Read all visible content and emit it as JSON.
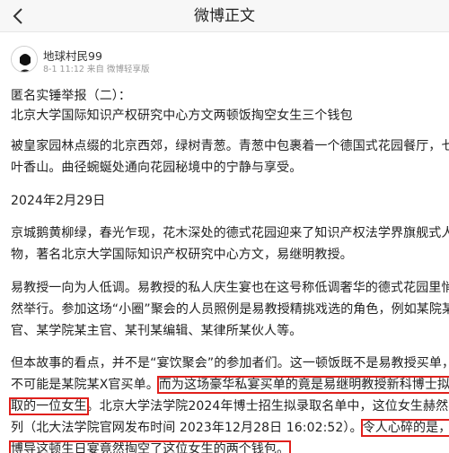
{
  "nav": {
    "title": "微博正文"
  },
  "author": {
    "name": "地球村民99",
    "meta": "8-1 11:12 来自 微博轻享版"
  },
  "post": {
    "l1": "匿名实锤举报（二）：",
    "l2": "北京大学国际知识产权研究中心方文两顿饭掏空女生三个钱包",
    "l3": "被皇家园林点缀的北京西郊，绿树青葱。青葱中包裹着一个德国式花园餐厅，七",
    "l4": "叶香山。曲径蜿蜒处通向花园秘境中的宁静与享受。",
    "l5": "2024年2月29日",
    "l6": "京城鹅黄柳绿，春光乍现，花木深处的德式花园迎来了知识产权法学界旗舰式人",
    "l7": "物，著名北京大学国际知识产权研究中心方文，易继明教授。",
    "l8": "易教授一向为人低调。易教授的私人庆生宴也在这号称低调奢华的德式花园里悄",
    "l9": "然举行。参加这场“小圈”聚会的人员照例是易教授精挑戏选的角色，例如某院某X",
    "l10": "官、某学院某主官、某刊某编辑、某律所某伙人等。",
    "l11": "但本故事的看点，并不是“宴饮聚会”的参加者们。这一顿饭既不是易教授买单，更",
    "l12a": "不可能是某院某X官买单。",
    "l12b": "而为这场豪华私宴买单的竟是易继明教授新科博士拟录",
    "l13a": "取的一位女生",
    "l13b": "。北京大学法学院2024年博士招生拟录取名单中，这位女生赫然在",
    "l14a": "列（北大法学院官网发布时间 2023年12月28日 16:02:52）。",
    "l14b": "令人心碎的是，易",
    "l15": "博导这顿生日宴竟然掏空了这位女生的两个钱包。"
  }
}
